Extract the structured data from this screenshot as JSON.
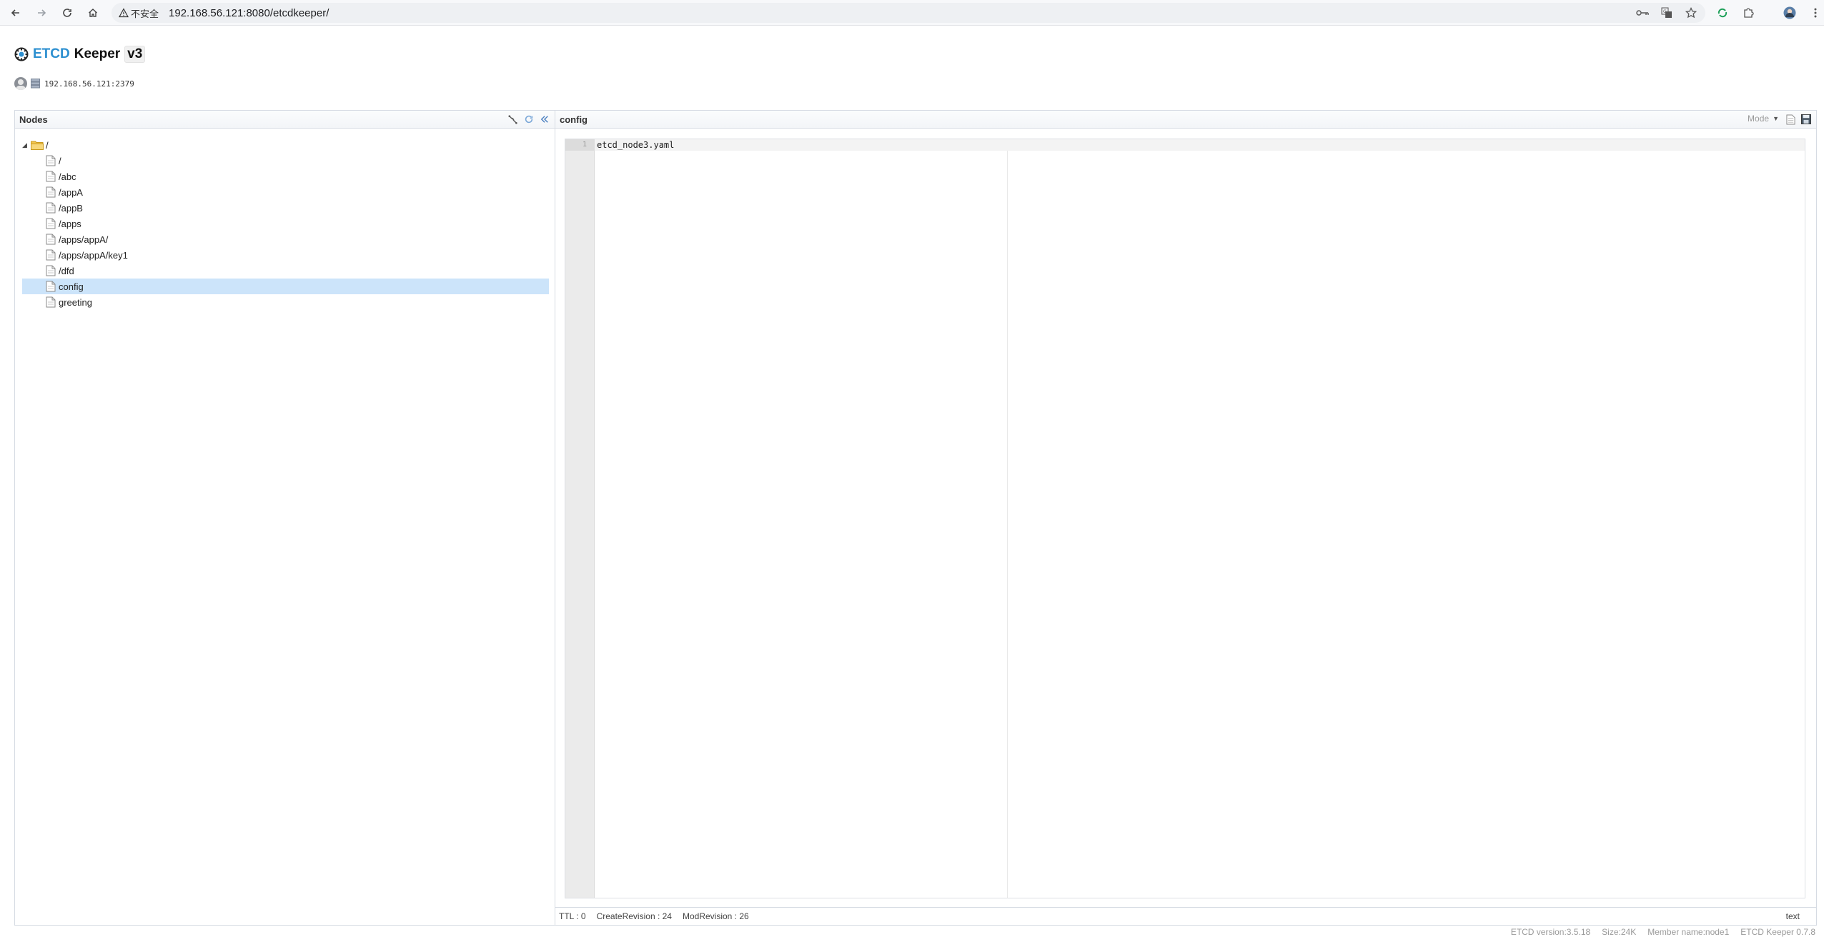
{
  "browser": {
    "security_label": "不安全",
    "url": "192.168.56.121:8080/etcdkeeper/"
  },
  "app": {
    "title_etcd": "ETCD",
    "title_keeper": "Keeper",
    "title_version": "v3",
    "server_address": "192.168.56.121:2379"
  },
  "nodes_panel": {
    "title": "Nodes",
    "root_label": "/",
    "items": [
      {
        "label": "/"
      },
      {
        "label": "/abc"
      },
      {
        "label": "/appA"
      },
      {
        "label": "/appB"
      },
      {
        "label": "/apps"
      },
      {
        "label": "/apps/appA/"
      },
      {
        "label": "/apps/appA/key1"
      },
      {
        "label": "/dfd"
      },
      {
        "label": "config"
      },
      {
        "label": "greeting"
      }
    ],
    "selected_index": 8
  },
  "editor": {
    "title": "config",
    "mode_label": "Mode",
    "line_number": "1",
    "content": "etcd_node3.yaml",
    "status": {
      "ttl": "TTL : 0",
      "create_revision": "CreateRevision : 24",
      "mod_revision": "ModRevision : 26",
      "mode": "text"
    }
  },
  "footer": {
    "etcd_version": "ETCD version:3.5.18",
    "size": "Size:24K",
    "member_name": "Member name:node1",
    "keeper_version": "ETCD Keeper 0.7.8"
  }
}
